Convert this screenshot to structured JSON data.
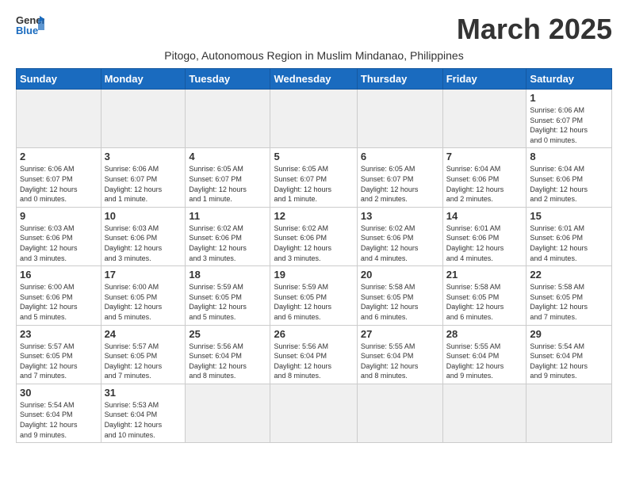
{
  "header": {
    "logo_general": "General",
    "logo_blue": "Blue",
    "month_title": "March 2025",
    "subtitle": "Pitogo, Autonomous Region in Muslim Mindanao, Philippines"
  },
  "weekdays": [
    "Sunday",
    "Monday",
    "Tuesday",
    "Wednesday",
    "Thursday",
    "Friday",
    "Saturday"
  ],
  "days": {
    "d1": {
      "num": "1",
      "info": "Sunrise: 6:06 AM\nSunset: 6:07 PM\nDaylight: 12 hours\nand 0 minutes."
    },
    "d2": {
      "num": "2",
      "info": "Sunrise: 6:06 AM\nSunset: 6:07 PM\nDaylight: 12 hours\nand 0 minutes."
    },
    "d3": {
      "num": "3",
      "info": "Sunrise: 6:06 AM\nSunset: 6:07 PM\nDaylight: 12 hours\nand 1 minute."
    },
    "d4": {
      "num": "4",
      "info": "Sunrise: 6:05 AM\nSunset: 6:07 PM\nDaylight: 12 hours\nand 1 minute."
    },
    "d5": {
      "num": "5",
      "info": "Sunrise: 6:05 AM\nSunset: 6:07 PM\nDaylight: 12 hours\nand 1 minute."
    },
    "d6": {
      "num": "6",
      "info": "Sunrise: 6:05 AM\nSunset: 6:07 PM\nDaylight: 12 hours\nand 2 minutes."
    },
    "d7": {
      "num": "7",
      "info": "Sunrise: 6:04 AM\nSunset: 6:06 PM\nDaylight: 12 hours\nand 2 minutes."
    },
    "d8": {
      "num": "8",
      "info": "Sunrise: 6:04 AM\nSunset: 6:06 PM\nDaylight: 12 hours\nand 2 minutes."
    },
    "d9": {
      "num": "9",
      "info": "Sunrise: 6:03 AM\nSunset: 6:06 PM\nDaylight: 12 hours\nand 3 minutes."
    },
    "d10": {
      "num": "10",
      "info": "Sunrise: 6:03 AM\nSunset: 6:06 PM\nDaylight: 12 hours\nand 3 minutes."
    },
    "d11": {
      "num": "11",
      "info": "Sunrise: 6:02 AM\nSunset: 6:06 PM\nDaylight: 12 hours\nand 3 minutes."
    },
    "d12": {
      "num": "12",
      "info": "Sunrise: 6:02 AM\nSunset: 6:06 PM\nDaylight: 12 hours\nand 3 minutes."
    },
    "d13": {
      "num": "13",
      "info": "Sunrise: 6:02 AM\nSunset: 6:06 PM\nDaylight: 12 hours\nand 4 minutes."
    },
    "d14": {
      "num": "14",
      "info": "Sunrise: 6:01 AM\nSunset: 6:06 PM\nDaylight: 12 hours\nand 4 minutes."
    },
    "d15": {
      "num": "15",
      "info": "Sunrise: 6:01 AM\nSunset: 6:06 PM\nDaylight: 12 hours\nand 4 minutes."
    },
    "d16": {
      "num": "16",
      "info": "Sunrise: 6:00 AM\nSunset: 6:06 PM\nDaylight: 12 hours\nand 5 minutes."
    },
    "d17": {
      "num": "17",
      "info": "Sunrise: 6:00 AM\nSunset: 6:05 PM\nDaylight: 12 hours\nand 5 minutes."
    },
    "d18": {
      "num": "18",
      "info": "Sunrise: 5:59 AM\nSunset: 6:05 PM\nDaylight: 12 hours\nand 5 minutes."
    },
    "d19": {
      "num": "19",
      "info": "Sunrise: 5:59 AM\nSunset: 6:05 PM\nDaylight: 12 hours\nand 6 minutes."
    },
    "d20": {
      "num": "20",
      "info": "Sunrise: 5:58 AM\nSunset: 6:05 PM\nDaylight: 12 hours\nand 6 minutes."
    },
    "d21": {
      "num": "21",
      "info": "Sunrise: 5:58 AM\nSunset: 6:05 PM\nDaylight: 12 hours\nand 6 minutes."
    },
    "d22": {
      "num": "22",
      "info": "Sunrise: 5:58 AM\nSunset: 6:05 PM\nDaylight: 12 hours\nand 7 minutes."
    },
    "d23": {
      "num": "23",
      "info": "Sunrise: 5:57 AM\nSunset: 6:05 PM\nDaylight: 12 hours\nand 7 minutes."
    },
    "d24": {
      "num": "24",
      "info": "Sunrise: 5:57 AM\nSunset: 6:05 PM\nDaylight: 12 hours\nand 7 minutes."
    },
    "d25": {
      "num": "25",
      "info": "Sunrise: 5:56 AM\nSunset: 6:04 PM\nDaylight: 12 hours\nand 8 minutes."
    },
    "d26": {
      "num": "26",
      "info": "Sunrise: 5:56 AM\nSunset: 6:04 PM\nDaylight: 12 hours\nand 8 minutes."
    },
    "d27": {
      "num": "27",
      "info": "Sunrise: 5:55 AM\nSunset: 6:04 PM\nDaylight: 12 hours\nand 8 minutes."
    },
    "d28": {
      "num": "28",
      "info": "Sunrise: 5:55 AM\nSunset: 6:04 PM\nDaylight: 12 hours\nand 9 minutes."
    },
    "d29": {
      "num": "29",
      "info": "Sunrise: 5:54 AM\nSunset: 6:04 PM\nDaylight: 12 hours\nand 9 minutes."
    },
    "d30": {
      "num": "30",
      "info": "Sunrise: 5:54 AM\nSunset: 6:04 PM\nDaylight: 12 hours\nand 9 minutes."
    },
    "d31": {
      "num": "31",
      "info": "Sunrise: 5:53 AM\nSunset: 6:04 PM\nDaylight: 12 hours\nand 10 minutes."
    }
  }
}
